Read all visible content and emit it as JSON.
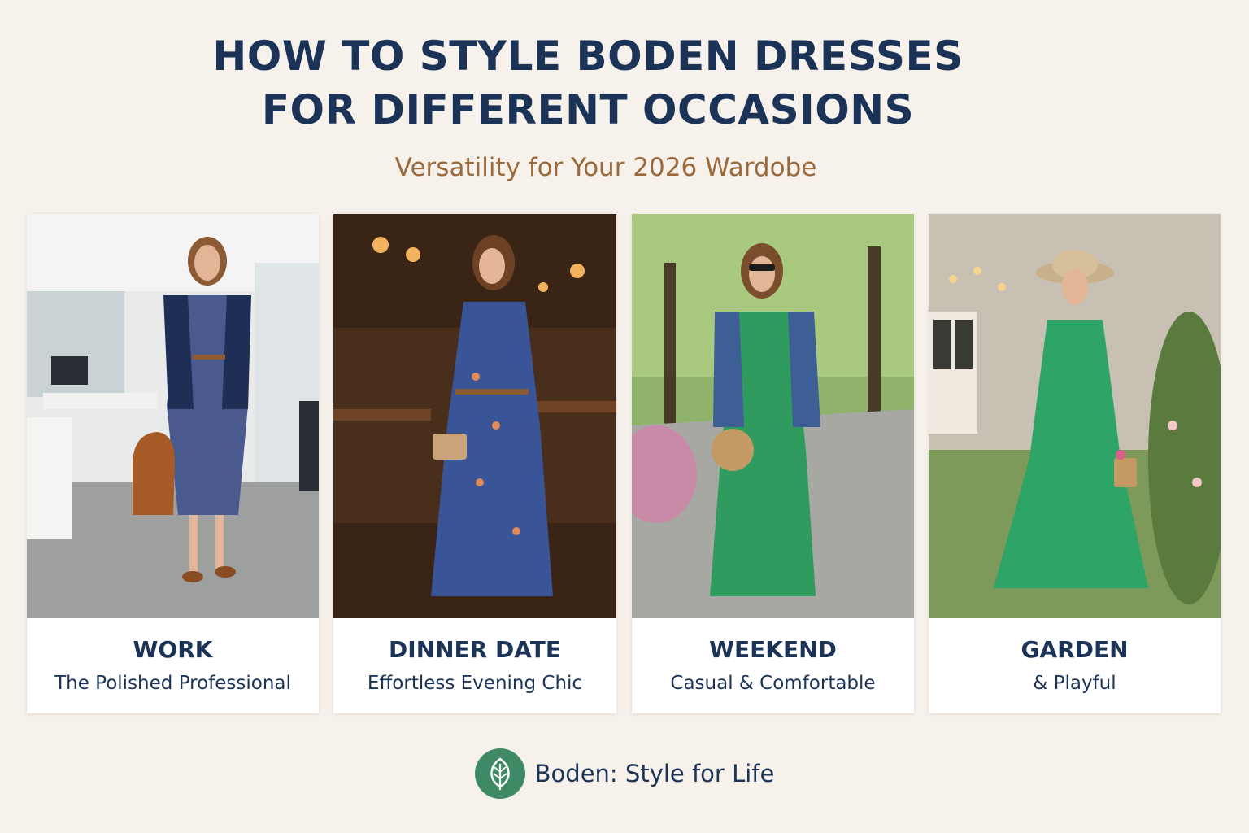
{
  "header": {
    "title_line1": "HOW TO STYLE BODEN DRESSES",
    "title_line2": "FOR DIFFERENT OCCASIONS",
    "subtitle": "Versatility for Your 2026 Wardobe"
  },
  "cards": [
    {
      "title": "WORK",
      "subtitle": "The Polished Professional",
      "scene": "office",
      "dress": "blue-floral-print-dress"
    },
    {
      "title": "DINNER DATE",
      "subtitle": "Effortless Evening Chic",
      "scene": "restaurant",
      "dress": "blue-geometric-print-dress"
    },
    {
      "title": "WEEKEND",
      "subtitle": "Casual & Comfortable",
      "scene": "tree-lined-street",
      "dress": "green-floral-dress"
    },
    {
      "title": "GARDEN",
      "subtitle": "& Playful",
      "scene": "garden",
      "dress": "green-floral-dress"
    }
  ],
  "footer": {
    "brand_text": "Boden: Style for Life",
    "logo_icon": "leaf-icon"
  },
  "colors": {
    "background": "#f6f1ea",
    "title": "#1c3358",
    "subtitle": "#9b6a3c",
    "logo": "#3f8a64"
  }
}
